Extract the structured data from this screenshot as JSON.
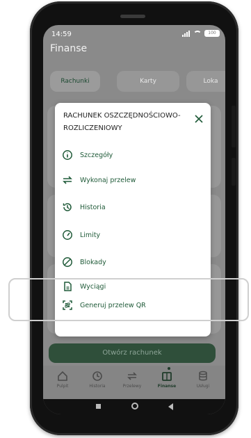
{
  "status": {
    "time": "14:59",
    "battery": "100"
  },
  "app": {
    "title": "Finanse"
  },
  "tabs": [
    {
      "label": "Rachunki"
    },
    {
      "label": "Karty"
    },
    {
      "label": "Loka"
    }
  ],
  "modal": {
    "title": "RACHUNEK OSZCZĘDNOŚCIOWO-ROZLICZENIOWY",
    "items": [
      {
        "label": "Szczegóły",
        "icon": "info-icon"
      },
      {
        "label": "Wykonaj przelew",
        "icon": "transfer-icon"
      },
      {
        "label": "Historia",
        "icon": "history-icon"
      },
      {
        "label": "Limity",
        "icon": "limits-icon"
      },
      {
        "label": "Blokady",
        "icon": "block-icon"
      },
      {
        "label": "Wyciągi",
        "icon": "statement-icon"
      },
      {
        "label": "Generuj przelew QR",
        "icon": "qr-icon"
      }
    ]
  },
  "open_account_button": "Otwórz rachunek",
  "bottom_nav": [
    {
      "label": "Pulpit",
      "icon": "home-icon"
    },
    {
      "label": "Historia",
      "icon": "history-icon"
    },
    {
      "label": "Przelewy",
      "icon": "transfer-icon"
    },
    {
      "label": "Finanse",
      "icon": "wallet-icon",
      "active": true
    },
    {
      "label": "Usługi",
      "icon": "database-icon"
    }
  ],
  "colors": {
    "accent": "#1f5a38",
    "overlay": "#8a8a8a"
  }
}
